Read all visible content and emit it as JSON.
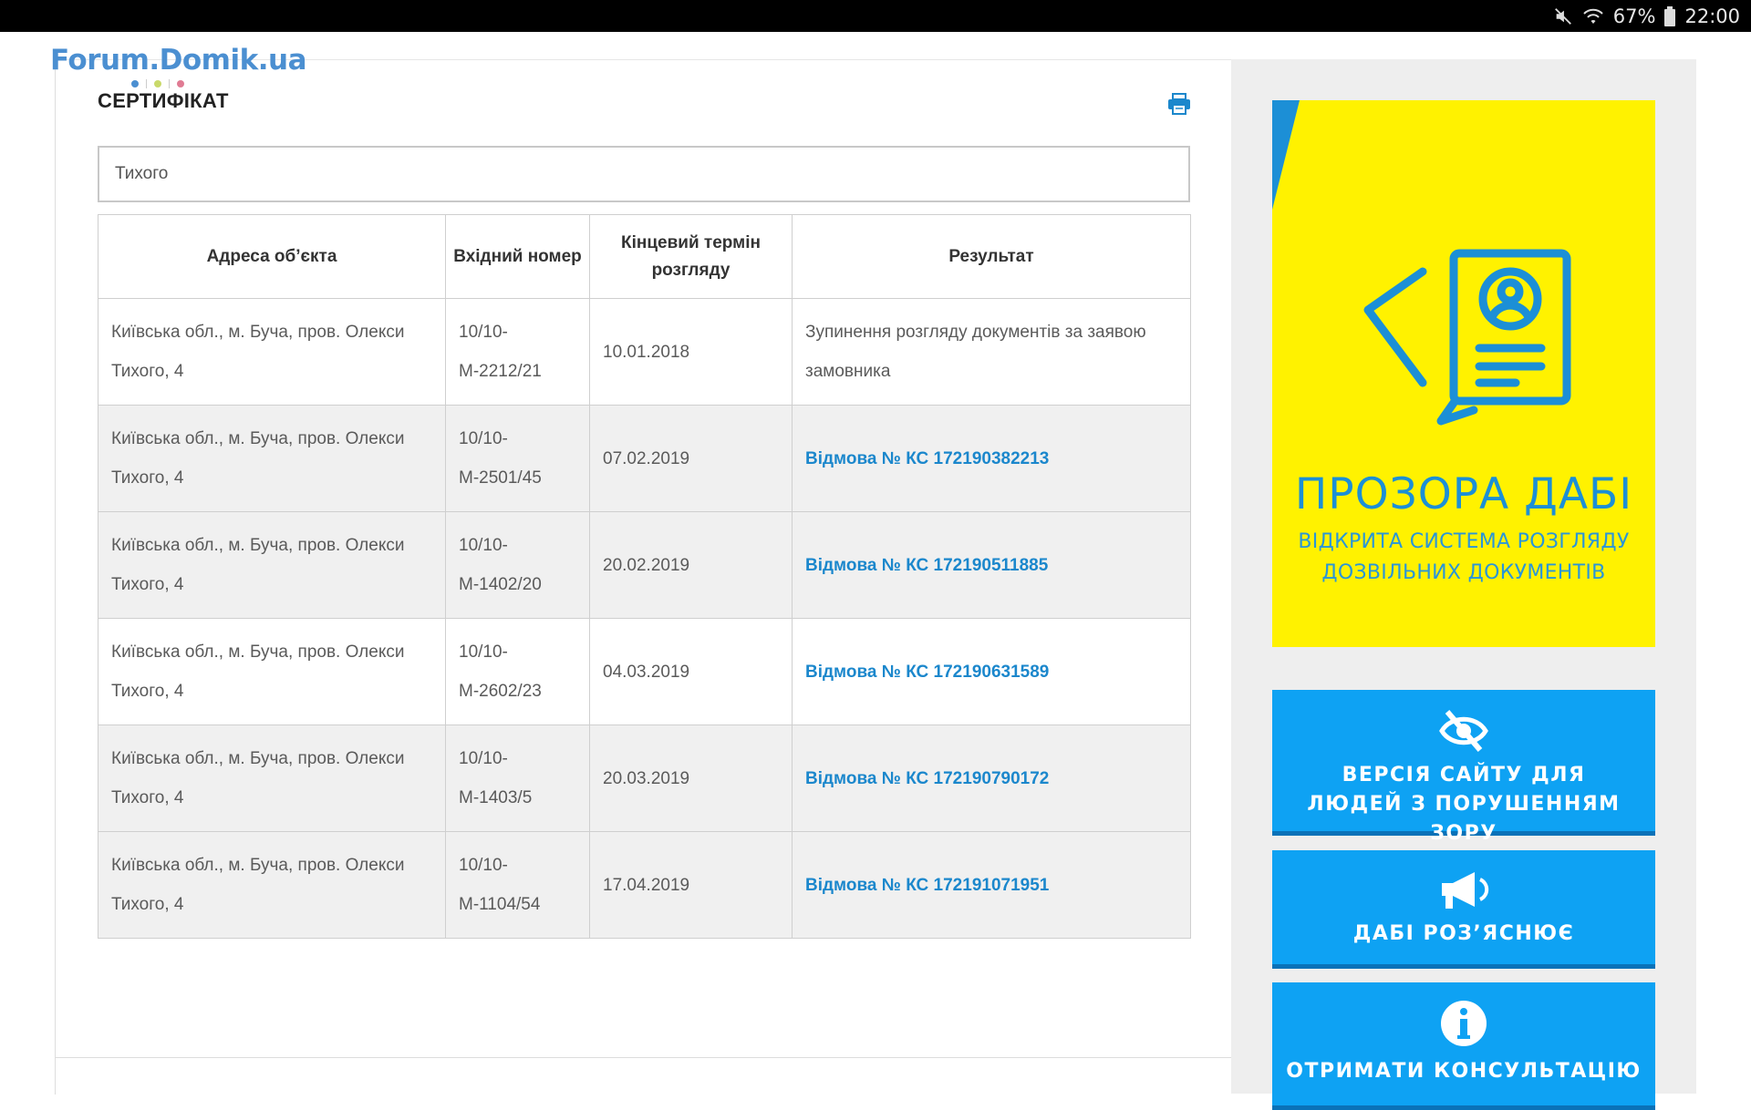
{
  "status_bar": {
    "battery": "67%",
    "time": "22:00"
  },
  "watermark": {
    "text": "Forum.Domik.ua",
    "dot_colors": [
      "#4b8fd1",
      "#c9d96a",
      "#e07b93"
    ]
  },
  "card": {
    "title": "СЕРТИФІКАТ",
    "print_icon": "print-icon"
  },
  "search": {
    "value": "Тихого"
  },
  "table": {
    "headers": [
      "Адреса об’єкта",
      "Вхідний номер",
      "Кінцевий термін розгляду",
      "Результат"
    ],
    "rows": [
      {
        "address": "Київська обл., м. Буча, пров. Олекси Тихого, 4",
        "number": "10/10-М-2212/21",
        "deadline": "10.01.2018",
        "result": "Зупинення розгляду документів за заявою замовника",
        "result_is_link": false
      },
      {
        "address": "Київська обл., м. Буча, пров. Олекси Тихого, 4",
        "number": "10/10-М-2501/45",
        "deadline": "07.02.2019",
        "result": "Відмова № КС 172190382213",
        "result_is_link": true
      },
      {
        "address": "Київська обл., м. Буча, пров. Олекси Тихого, 4",
        "number": "10/10-М-1402/20",
        "deadline": "20.02.2019",
        "result": "Відмова № КС 172190511885",
        "result_is_link": true
      },
      {
        "address": "Київська обл., м. Буча, пров. Олекси Тихого, 4",
        "number": "10/10-М-2602/23",
        "deadline": "04.03.2019",
        "result": "Відмова № КС 172190631589",
        "result_is_link": true
      },
      {
        "address": "Київська обл., м. Буча, пров. Олекси Тихого, 4",
        "number": "10/10-М-1403/5",
        "deadline": "20.03.2019",
        "result": "Відмова № КС 172190790172",
        "result_is_link": true
      },
      {
        "address": "Київська обл., м. Буча, пров. Олекси Тихого, 4",
        "number": "10/10-М-1104/54",
        "deadline": "17.04.2019",
        "result": "Відмова № КС 172191071951",
        "result_is_link": true
      }
    ]
  },
  "banner": {
    "title": "ПРОЗОРА ДАБІ",
    "subtitle": "ВІДКРИТА СИСТЕМА РОЗГЛЯДУ ДОЗВІЛЬНИХ ДОКУМЕНТІВ",
    "background": "#fff200",
    "accent": "#1c8fd6"
  },
  "sidebar_buttons": [
    {
      "label": "ВЕРСІЯ САЙТУ ДЛЯ ЛЮДЕЙ З ПОРУШЕННЯМ ЗОРУ",
      "icon": "eye-slash-icon"
    },
    {
      "label": "ДАБІ РОЗ’ЯСНЮЄ",
      "icon": "megaphone-icon"
    },
    {
      "label": "ОТРИМАТИ КОНСУЛЬТАЦІЮ",
      "icon": "info-icon"
    }
  ],
  "colors": {
    "link": "#1b87cc",
    "button": "#0ea2f3",
    "row_alt": "#f0f0f0"
  }
}
